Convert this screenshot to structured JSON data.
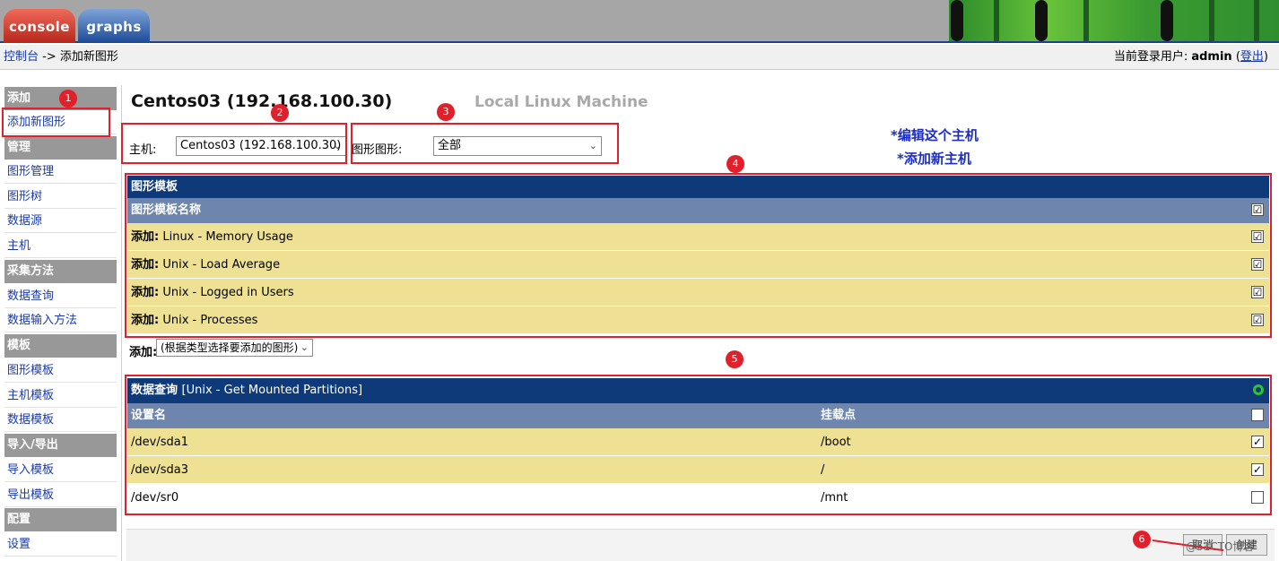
{
  "header": {
    "tabs": [
      {
        "label": "console"
      },
      {
        "label": "graphs"
      }
    ]
  },
  "breadcrumb": {
    "home": "控制台",
    "separator": " -> ",
    "current": "添加新图形"
  },
  "user": {
    "prefix": "当前登录用户: ",
    "name": "admin",
    "open": " (",
    "logout": "登出",
    "close": ")"
  },
  "sidebar": {
    "add_header": "添加",
    "add_new_graph": "添加新图形",
    "manage_header": "管理",
    "graph_manage": "图形管理",
    "graph_tree": "图形树",
    "data_source": "数据源",
    "host": "主机",
    "collect_header": "采集方法",
    "data_query": "数据查询",
    "data_input": "数据输入方法",
    "template_header": "模板",
    "graph_template": "图形模板",
    "host_template": "主机模板",
    "data_template": "数据模板",
    "io_header": "导入/导出",
    "import_template": "导入模板",
    "export_template": "导出模板",
    "config_header": "配置",
    "settings": "设置"
  },
  "main": {
    "title": "Centos03 (192.168.100.30)",
    "subtitle": "Local Linux Machine",
    "host_label": "主机:",
    "host_value": "Centos03 (192.168.100.30)",
    "graph_type_label": "图形图形:",
    "graph_type_value": "全部",
    "edit_host_link": "*编辑这个主机",
    "add_host_link": "*添加新主机"
  },
  "graph_templates": {
    "title": "图形模板",
    "column": "图形模板名称",
    "add_prefix": "添加:",
    "rows": [
      {
        "name": "Linux - Memory Usage",
        "checked": "☑"
      },
      {
        "name": "Unix - Load Average",
        "checked": "☑"
      },
      {
        "name": "Unix - Logged in Users",
        "checked": "☑"
      },
      {
        "name": "Unix - Processes",
        "checked": "☑"
      }
    ],
    "add_label": "添加:",
    "add_select": "(根据类型选择要添加的图形)"
  },
  "data_query": {
    "title": "数据查询",
    "query_name": "[Unix - Get Mounted Partitions]",
    "col_device": "设置名",
    "col_mount": "挂载点",
    "rows": [
      {
        "device": "/dev/sda1",
        "mount": "/boot",
        "checked": true
      },
      {
        "device": "/dev/sda3",
        "mount": "/",
        "checked": true
      },
      {
        "device": "/dev/sr0",
        "mount": "/mnt",
        "checked": false
      }
    ]
  },
  "badges": [
    "1",
    "2",
    "3",
    "4",
    "5",
    "6"
  ],
  "footer": {
    "cancel": "取消",
    "create": "创建",
    "watermark": "@51CTO博客"
  },
  "colors": {
    "accent_red": "#e0202a",
    "title_bar": "#0e3a7a",
    "header_bar": "#6e86ad",
    "row_yellow": "#efe193",
    "link_blue": "#1a3aa8"
  }
}
